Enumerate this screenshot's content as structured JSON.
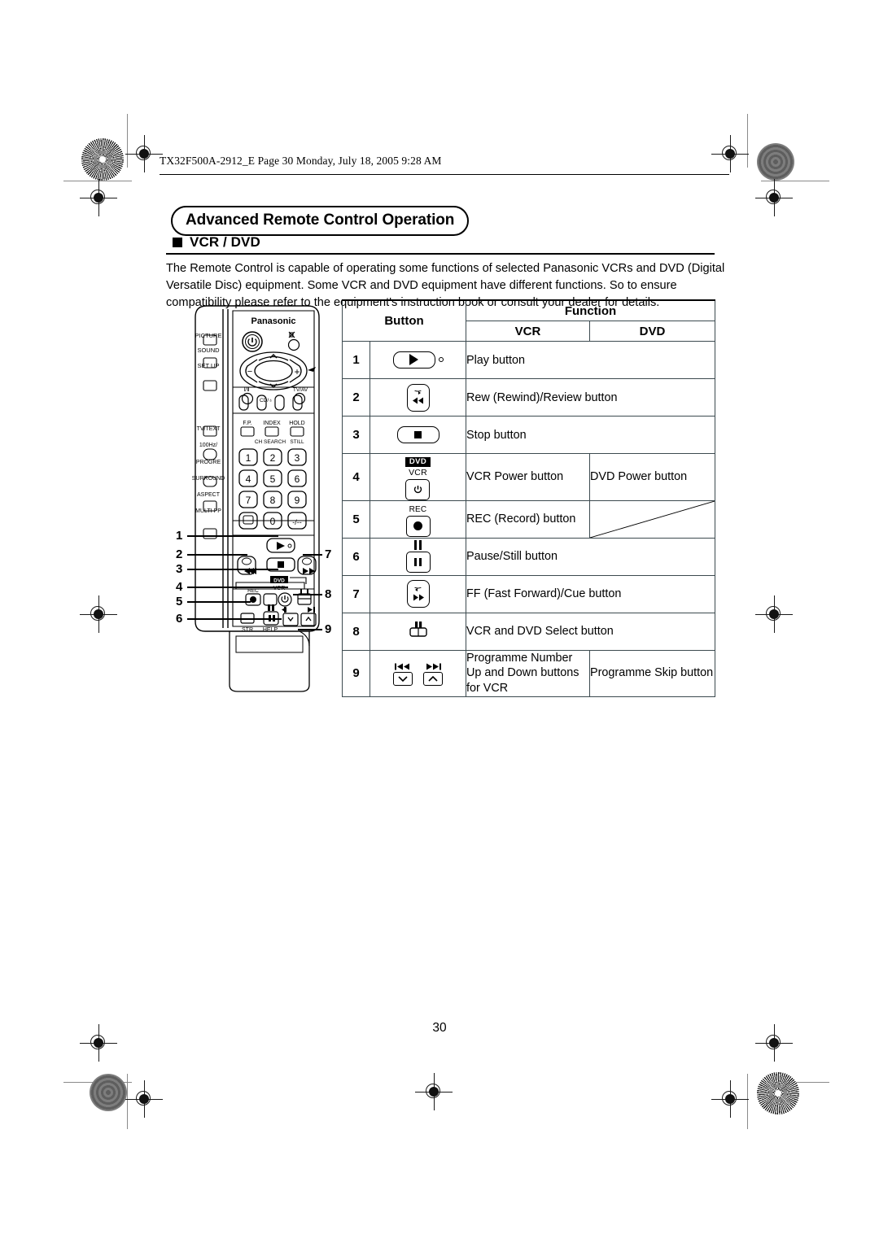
{
  "file_header": "TX32F500A-2912_E  Page 30  Monday, July 18, 2005  9:28 AM",
  "section": {
    "title": "Advanced Remote Control Operation",
    "subhead": "VCR / DVD",
    "intro": "The Remote Control is capable of operating some functions of selected Panasonic VCRs and DVD (Digital Versatile Disc) equipment. Some VCR and DVD equipment have different functions. So to ensure compatibility please refer to the equipment's instruction book or consult your dealer for details."
  },
  "table": {
    "header": {
      "button": "Button",
      "function": "Function",
      "vcr": "VCR",
      "dvd": "DVD"
    },
    "rows": [
      {
        "num": "1",
        "icon": "play-button-icon",
        "vcr": "Play button",
        "dvd": "",
        "span": true
      },
      {
        "num": "2",
        "icon": "rewind-button-icon",
        "vcr": "Rew (Rewind)/Review button",
        "dvd": "",
        "span": true
      },
      {
        "num": "3",
        "icon": "stop-button-icon",
        "vcr": "Stop button",
        "dvd": "",
        "span": true
      },
      {
        "num": "4",
        "icon": "vcr-dvd-power-icon",
        "vcr": "VCR Power button",
        "dvd": "DVD Power button",
        "span": false
      },
      {
        "num": "5",
        "icon": "record-button-icon",
        "vcr": "REC (Record) button",
        "dvd": "",
        "span": false,
        "dvd_struck": true
      },
      {
        "num": "6",
        "icon": "pause-still-button-icon",
        "vcr": "Pause/Still button",
        "dvd": "",
        "span": true
      },
      {
        "num": "7",
        "icon": "fast-forward-button-icon",
        "vcr": "FF (Fast Forward)/Cue button",
        "dvd": "",
        "span": true
      },
      {
        "num": "8",
        "icon": "vcr-dvd-select-icon",
        "vcr": "VCR and DVD Select button",
        "dvd": "",
        "span": true
      },
      {
        "num": "9",
        "icon": "programme-skip-icon",
        "vcr": "Programme Number Up and  Down buttons for VCR",
        "dvd": "Programme Skip button",
        "span": false
      }
    ],
    "icon_labels": {
      "dvd_badge": "DVD",
      "vcr_small": "VCR",
      "rec_small": "REC"
    }
  },
  "remote": {
    "brand": "Panasonic",
    "side_labels": [
      "PICTURE",
      "SOUND",
      "SET UP",
      "TV/TEXT",
      "100Hz/ PROGRE",
      "SURROUND",
      "ASPECT",
      "MULTI PP"
    ],
    "pad_labels": {
      "minus": "−",
      "plus": "+",
      "up": "∧",
      "down": "∨"
    },
    "bottom_left_label": "I/Ⅱ",
    "cd_label": "CD/♁",
    "tv_av_label": "TV/AV",
    "fn_labels": [
      "F.P.",
      "INDEX",
      "HOLD"
    ],
    "fn_sub_labels": [
      "CH SEARCH",
      "STILL"
    ],
    "keypad": [
      "1",
      "2",
      "3",
      "4",
      "5",
      "6",
      "7",
      "8",
      "9",
      "0",
      "-/--"
    ],
    "lower_labels": [
      "REC",
      "STR",
      "HELP"
    ],
    "help_glyph": "?",
    "callouts": [
      "1",
      "2",
      "3",
      "4",
      "5",
      "6",
      "7",
      "8",
      "9"
    ]
  },
  "page_number": "30"
}
